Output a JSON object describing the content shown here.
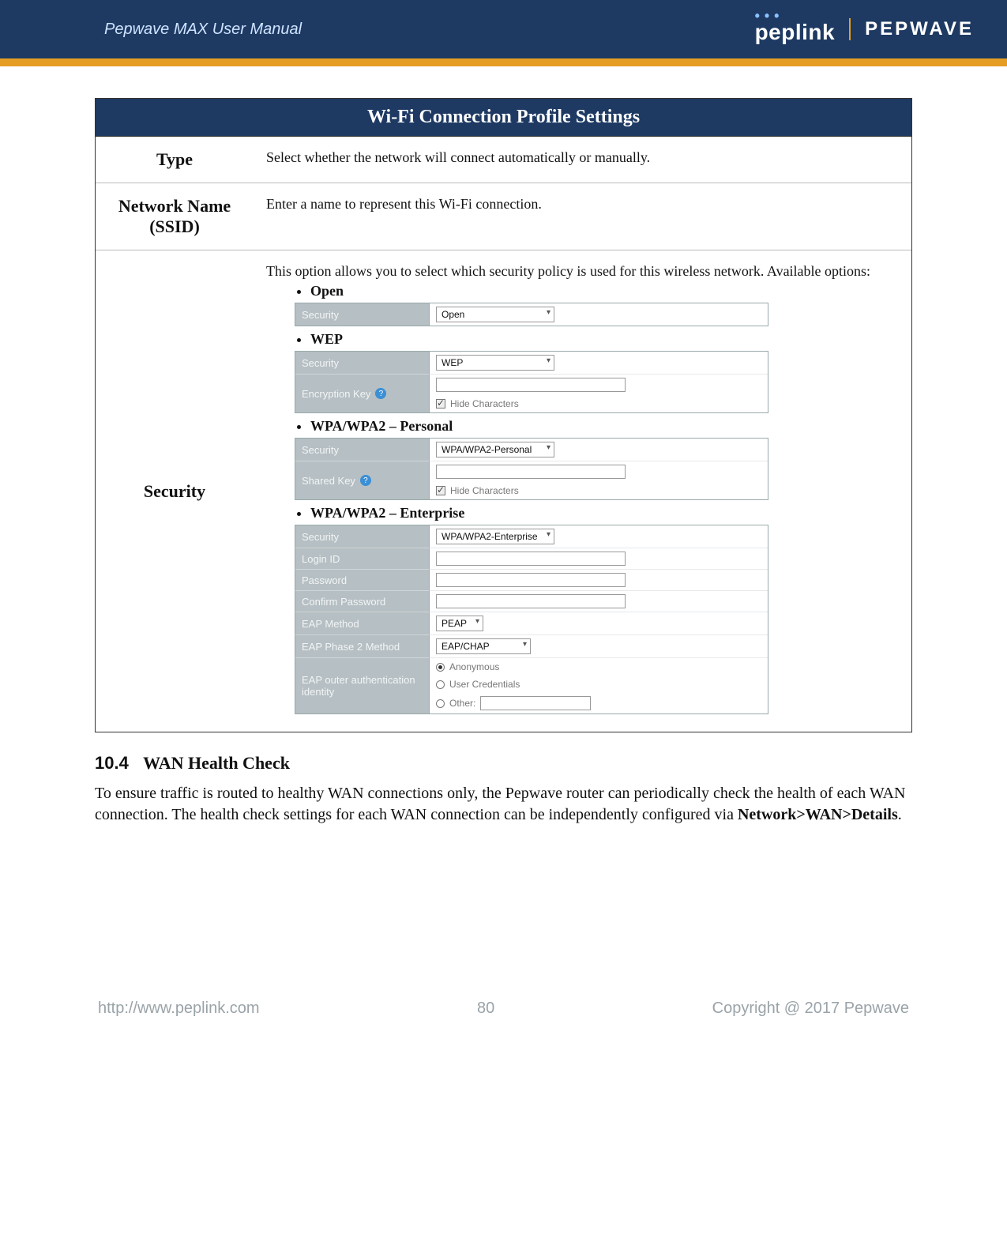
{
  "banner": {
    "title": "Pepwave MAX User Manual",
    "brand_pep": "peplink",
    "brand_wave": "PEPWAVE"
  },
  "settings": {
    "title": "Wi-Fi Connection Profile Settings",
    "rows": {
      "type": {
        "label": "Type",
        "desc": "Select whether the network will connect automatically or manually."
      },
      "ssid": {
        "label": "Network Name (SSID)",
        "desc": "Enter a name to represent this Wi-Fi connection."
      },
      "security": {
        "label": "Security",
        "desc": "This option allows you to select which security policy is used for this wireless network. Available options:"
      }
    },
    "options": {
      "open": {
        "heading": "Open",
        "security_label": "Security",
        "security_value": "Open"
      },
      "wep": {
        "heading": "WEP",
        "security_label": "Security",
        "security_value": "WEP",
        "key_label": "Encryption Key",
        "hide_label": "Hide Characters"
      },
      "wpa_personal": {
        "heading": "WPA/WPA2 – Personal",
        "security_label": "Security",
        "security_value": "WPA/WPA2-Personal",
        "key_label": "Shared Key",
        "hide_label": "Hide Characters"
      },
      "wpa_enterprise": {
        "heading": "WPA/WPA2 – Enterprise",
        "security_label": "Security",
        "security_value": "WPA/WPA2-Enterprise",
        "login_label": "Login ID",
        "password_label": "Password",
        "confirm_label": "Confirm Password",
        "eap_label": "EAP Method",
        "eap_value": "PEAP",
        "eap2_label": "EAP Phase 2 Method",
        "eap2_value": "EAP/CHAP",
        "outer_label": "EAP outer authentication identity",
        "outer_opts": {
          "anon": "Anonymous",
          "user": "User Credentials",
          "other": "Other:"
        }
      }
    }
  },
  "section": {
    "num": "10.4",
    "title": "WAN Health Check",
    "para_pre": "To ensure traffic is routed to healthy WAN connections only, the Pepwave router can periodically check the health of each WAN connection. The health check settings for each WAN connection can be independently configured via ",
    "para_bold": "Network>WAN>Details",
    "para_post": "."
  },
  "footer": {
    "url": "http://www.peplink.com",
    "page": "80",
    "copyright": "Copyright @ 2017 Pepwave"
  }
}
